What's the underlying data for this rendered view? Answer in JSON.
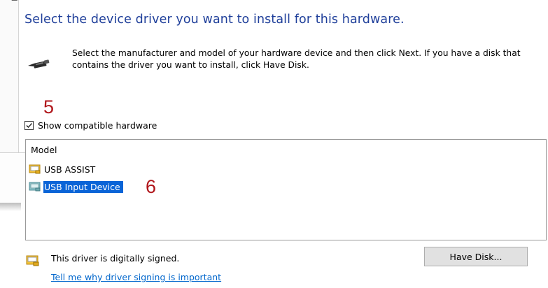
{
  "dialog": {
    "title": "Select the device driver you want to install for this hardware.",
    "description": "Select the manufacturer and model of your hardware device and then click Next. If you have a disk that contains the driver you want to install, click Have Disk.",
    "show_compatible_label": "Show compatible hardware",
    "show_compatible_checked": true
  },
  "annotations": {
    "step5": "5",
    "step6": "6"
  },
  "model_list": {
    "header": "Model",
    "items": [
      {
        "label": "USB ASSIST",
        "selected": false
      },
      {
        "label": "USB Input Device",
        "selected": true
      }
    ]
  },
  "footer": {
    "signed_text": "This driver is digitally signed.",
    "link_text": "Tell me why driver signing is important",
    "have_disk_label": "Have Disk..."
  },
  "colors": {
    "title": "#1f3f9a",
    "annotation": "#b0161b",
    "selection": "#0a64d7",
    "link": "#0066cc"
  },
  "icons": {
    "device": "usb-cable-icon",
    "driver_item": "driver-package-icon",
    "signed": "certificate-icon"
  }
}
